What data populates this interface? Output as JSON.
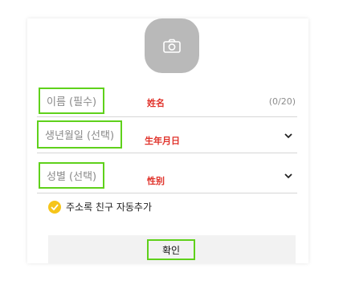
{
  "form": {
    "photo": {
      "icon": "camera-icon"
    },
    "name": {
      "label": "이름 (필수)",
      "value": "姓名",
      "counter": "(0/20)"
    },
    "birthdate": {
      "label": "생년월일 (선택)",
      "value": "生年月日",
      "icon": "chevron-down-icon"
    },
    "gender": {
      "label": "성별 (선택)",
      "value": "性别",
      "icon": "chevron-down-icon"
    },
    "add_contacts": {
      "label": "주소록 친구 자동추가",
      "checked": true,
      "icon": "checkmark-icon",
      "color": "#f6c51a"
    },
    "confirm_label": "확인"
  },
  "colors": {
    "highlight_border": "#5fd11b",
    "value_text": "#e0322a",
    "avatar_bg": "#b9b9b9",
    "confirm_bg": "#f2f2f2"
  }
}
